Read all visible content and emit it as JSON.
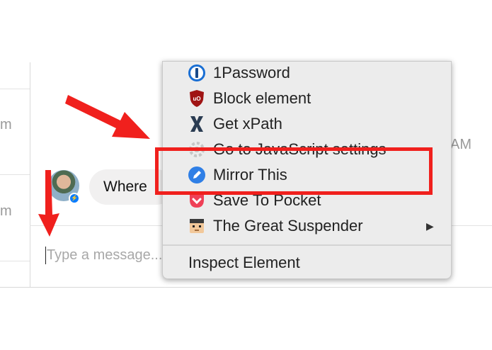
{
  "background": {
    "left_timestamps": [
      "m",
      "m"
    ],
    "right_timestamp": "AM",
    "message_bubble_text": "Where",
    "compose_placeholder": "Type a message..."
  },
  "context_menu": {
    "items": [
      {
        "label": "1Password",
        "icon": "1password-icon"
      },
      {
        "label": "Block element",
        "icon": "ublock-shield-icon"
      },
      {
        "label": "Get xPath",
        "icon": "xpath-x-icon"
      },
      {
        "label": "Go to JavaScript settings",
        "icon": "gear-icon"
      },
      {
        "label": "Mirror This",
        "icon": "pencil-circle-icon"
      },
      {
        "label": "Save To Pocket",
        "icon": "pocket-icon"
      },
      {
        "label": "The Great Suspender",
        "icon": "suspender-face-icon",
        "submenu_arrow": "▶"
      }
    ],
    "inspect_label": "Inspect Element"
  },
  "annotations": {
    "highlight_color": "#f0201d",
    "arrow_color": "#f0201d",
    "highlighted_item": "Mirror This"
  },
  "colors": {
    "menu_bg": "#ececec",
    "messenger_blue": "#0a7cff",
    "bubble_bg": "#f1f0f0"
  }
}
